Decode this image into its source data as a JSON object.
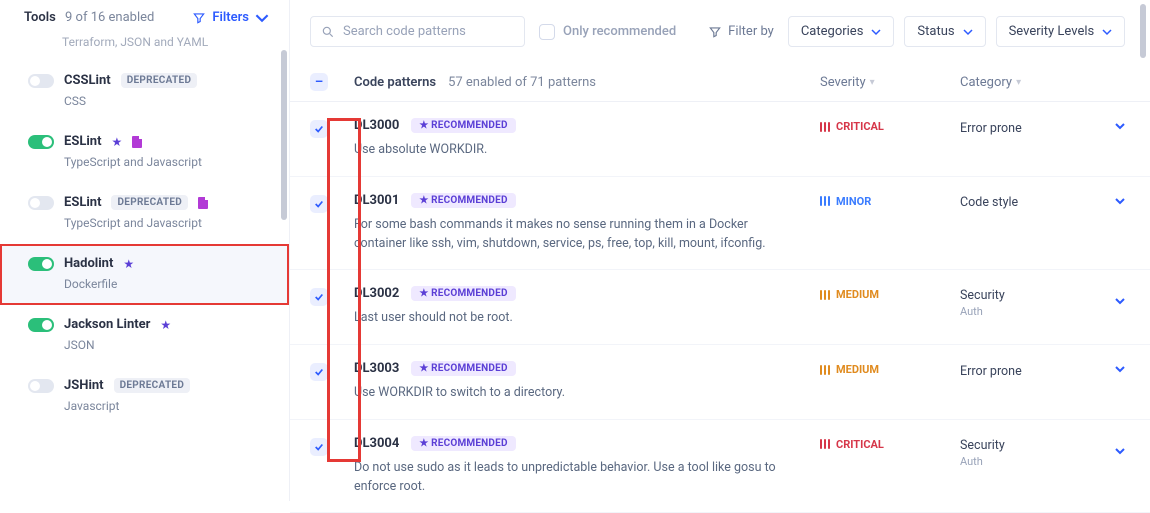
{
  "sidebar": {
    "title": "Tools",
    "subtitle": "9 of 16 enabled",
    "filters_label": "Filters",
    "truncated_first": "Terraform, JSON and YAML",
    "items": [
      {
        "name": "CSSLint",
        "sub": "CSS",
        "enabled": false,
        "badges": [
          "deprecated"
        ],
        "deprecated_label": "DEPRECATED"
      },
      {
        "name": "ESLint",
        "sub": "TypeScript and Javascript",
        "enabled": true,
        "badges": [
          "star",
          "doc"
        ]
      },
      {
        "name": "ESLint",
        "sub": "TypeScript and Javascript",
        "enabled": false,
        "badges": [
          "deprecated",
          "doc"
        ],
        "deprecated_label": "DEPRECATED"
      },
      {
        "name": "Hadolint",
        "sub": "Dockerfile",
        "enabled": true,
        "badges": [
          "star"
        ],
        "selected": true
      },
      {
        "name": "Jackson Linter",
        "sub": "JSON",
        "enabled": true,
        "badges": [
          "star"
        ]
      },
      {
        "name": "JSHint",
        "sub": "Javascript",
        "enabled": false,
        "badges": [
          "deprecated"
        ],
        "deprecated_label": "DEPRECATED"
      }
    ]
  },
  "main": {
    "search_placeholder": "Search code patterns",
    "only_recommended": "Only recommended",
    "filter_by": "Filter by",
    "dropdowns": [
      "Categories",
      "Status",
      "Severity Levels"
    ],
    "header": {
      "code_patterns": "Code patterns",
      "enabled_text": "57 enabled of 71 patterns",
      "severity": "Severity",
      "category": "Category"
    },
    "recommended_label": "RECOMMENDED",
    "patterns": [
      {
        "id": "DL3000",
        "desc": "Use absolute WORKDIR.",
        "severity": "CRITICAL",
        "sev_class": "critical",
        "category": "Error prone",
        "cat_sub": ""
      },
      {
        "id": "DL3001",
        "desc": "For some bash commands it makes no sense running them in a Docker container like ssh, vim, shutdown, service, ps, free, top, kill, mount, ifconfig.",
        "severity": "MINOR",
        "sev_class": "minor",
        "category": "Code style",
        "cat_sub": ""
      },
      {
        "id": "DL3002",
        "desc": "Last user should not be root.",
        "severity": "MEDIUM",
        "sev_class": "medium",
        "category": "Security",
        "cat_sub": "Auth"
      },
      {
        "id": "DL3003",
        "desc": "Use WORKDIR to switch to a directory.",
        "severity": "MEDIUM",
        "sev_class": "medium",
        "category": "Error prone",
        "cat_sub": ""
      },
      {
        "id": "DL3004",
        "desc": "Do not use sudo as it leads to unpredictable behavior. Use a tool like gosu to enforce root.",
        "severity": "CRITICAL",
        "sev_class": "critical",
        "category": "Security",
        "cat_sub": "Auth"
      }
    ]
  }
}
